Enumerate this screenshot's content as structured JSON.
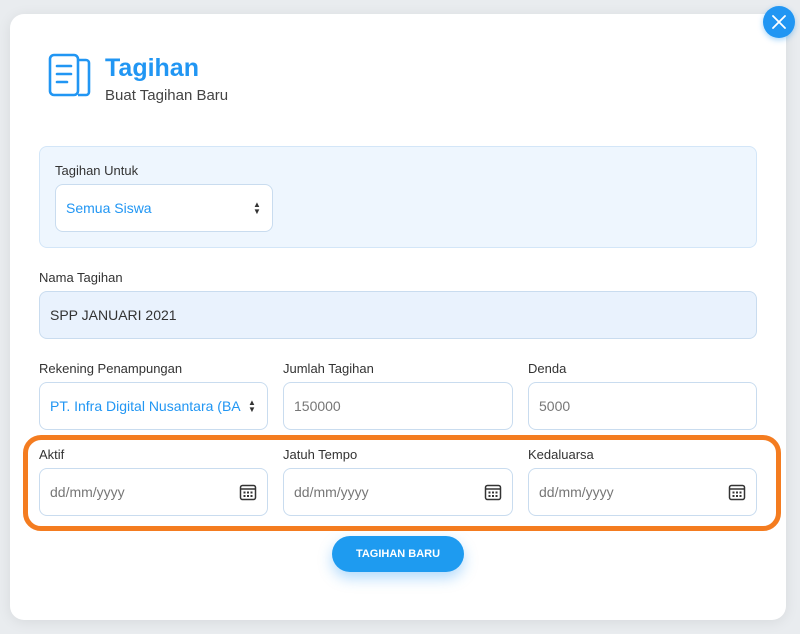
{
  "header": {
    "title": "Tagihan",
    "subtitle": "Buat Tagihan Baru",
    "icon": "document-icon"
  },
  "form": {
    "tagihan_untuk": {
      "label": "Tagihan Untuk",
      "value": "Semua Siswa"
    },
    "nama_tagihan": {
      "label": "Nama Tagihan",
      "value": "SPP JANUARI 2021"
    },
    "rekening": {
      "label": "Rekening Penampungan",
      "value": "PT. Infra Digital Nusantara (BA"
    },
    "jumlah": {
      "label": "Jumlah Tagihan",
      "value": "150000"
    },
    "denda": {
      "label": "Denda",
      "value": "5000"
    },
    "aktif": {
      "label": "Aktif",
      "placeholder": "dd/mm/yyyy"
    },
    "jatuh_tempo": {
      "label": "Jatuh Tempo",
      "placeholder": "dd/mm/yyyy"
    },
    "kedaluarsa": {
      "label": "Kedaluarsa",
      "placeholder": "dd/mm/yyyy"
    }
  },
  "actions": {
    "submit_label": "TAGIHAN BARU"
  },
  "colors": {
    "accent": "#2196f3",
    "highlight": "#f47c20",
    "panel": "#eef6fe"
  }
}
